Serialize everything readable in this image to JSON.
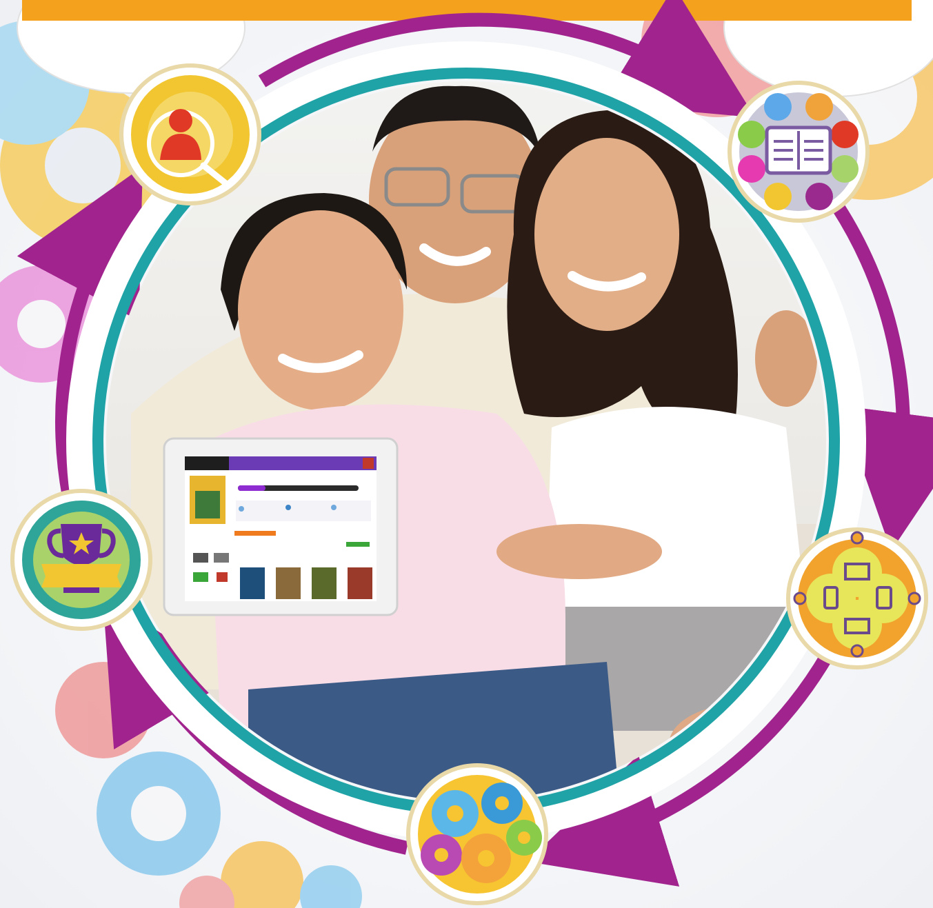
{
  "colors": {
    "banner": "#F4A11D",
    "ring_purple": "#A1248E",
    "ring_teal": "#1FA3A6",
    "badge_border": "#E9D9A8",
    "page_bg": "#F7F7F9",
    "tablet_topbar": "#6A3BB4",
    "tablet_progress": "#8E2BD1"
  },
  "badges": [
    {
      "icon": "member-search-icon"
    },
    {
      "icon": "open-book-network-icon"
    },
    {
      "icon": "multi-device-icon"
    },
    {
      "icon": "gears-icon"
    },
    {
      "icon": "trophy-icon"
    }
  ],
  "tablet": {
    "topbar_brand": "",
    "screen_has_book_covers": 4
  }
}
